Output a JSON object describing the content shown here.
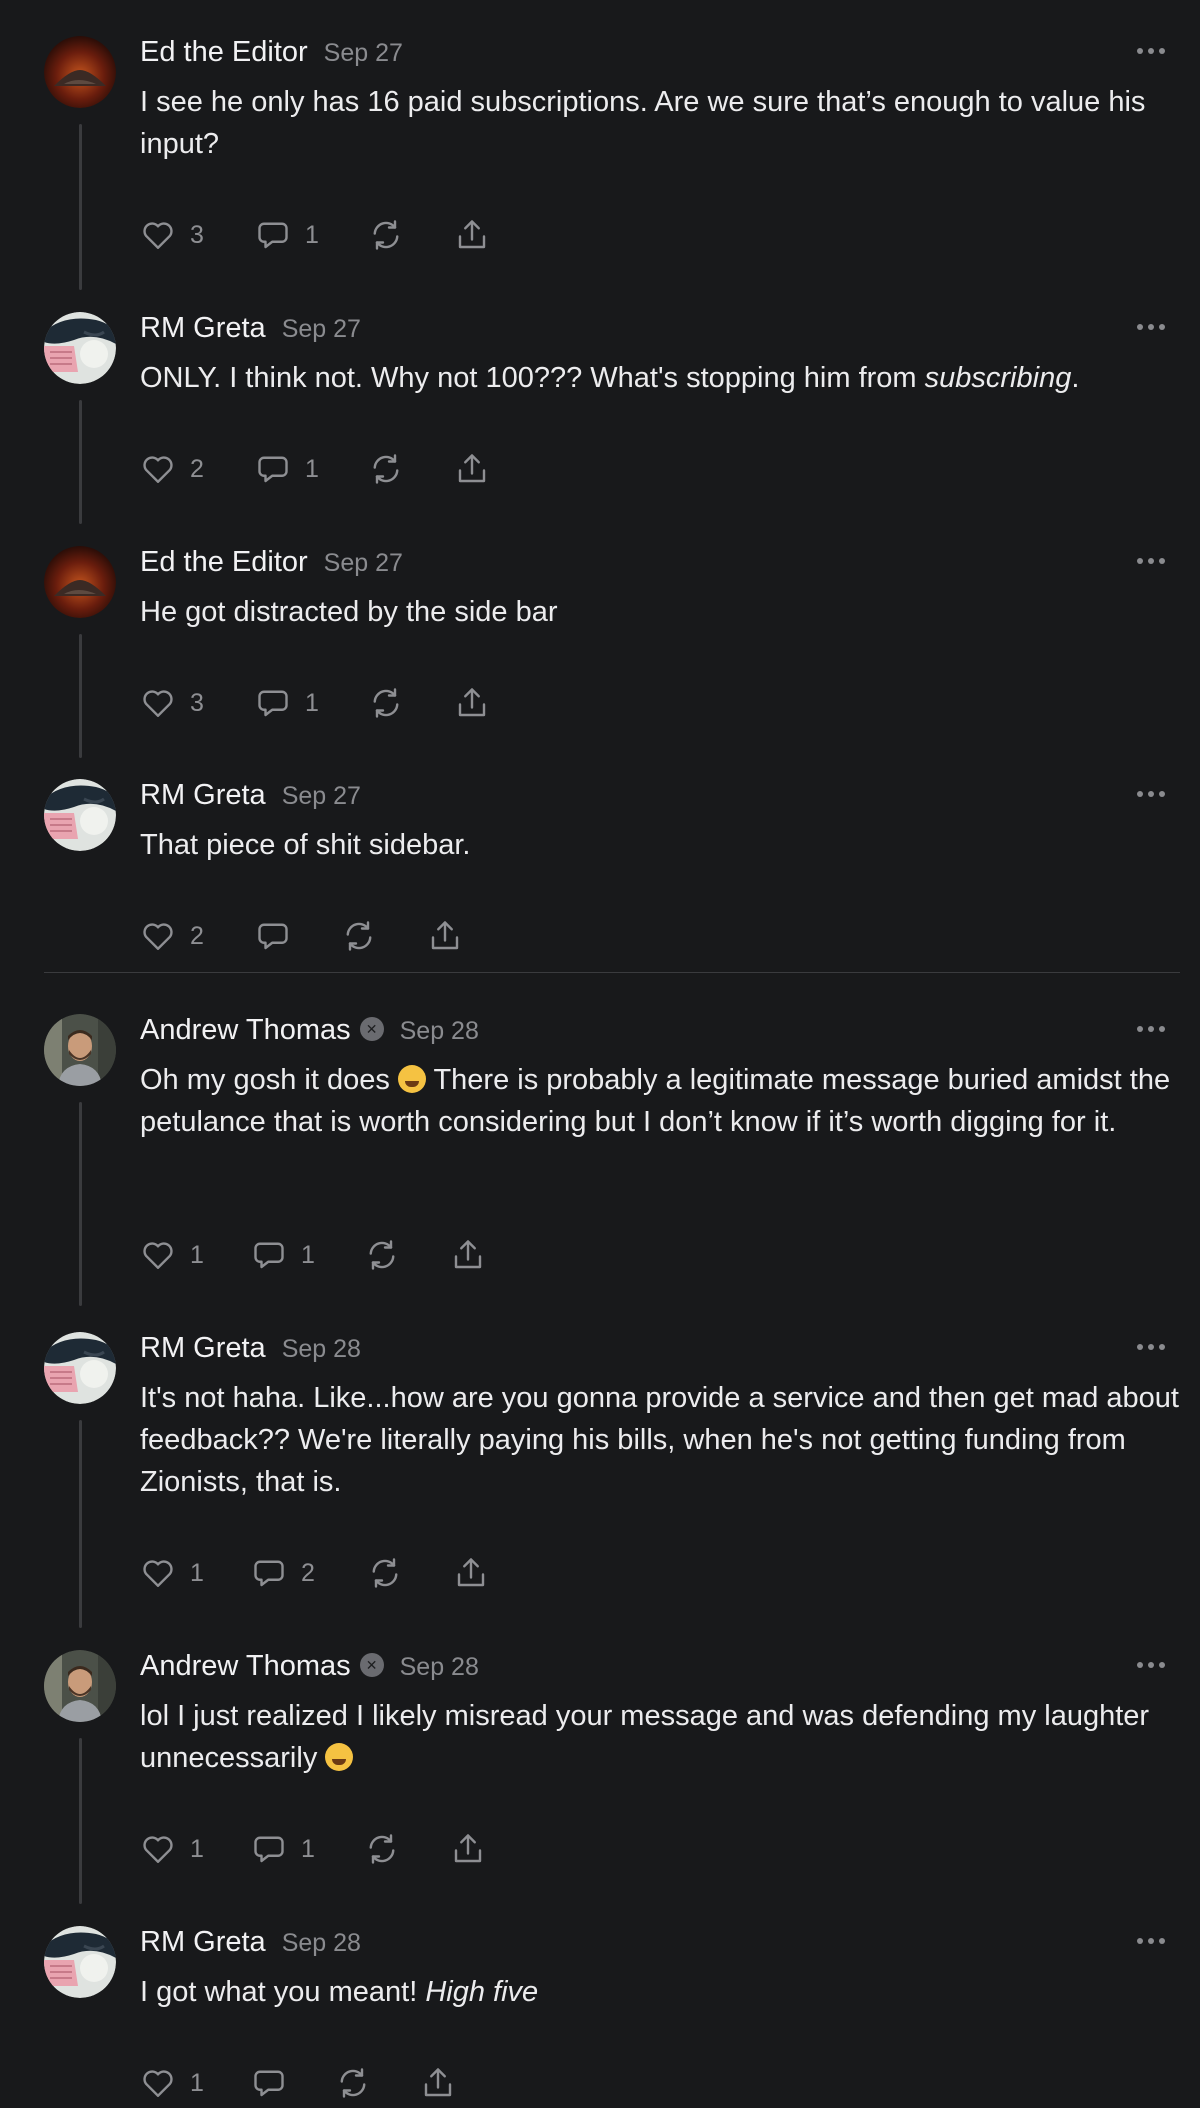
{
  "comments": [
    {
      "author": "Ed the Editor",
      "date": "Sep 27",
      "text": "I see he only has 16 paid subscriptions. Are we sure that’s enough to value his input?",
      "likes": "3",
      "replies": "1",
      "avatar": "mountain"
    },
    {
      "author": "RM Greta",
      "date": "Sep 27",
      "text_before": "ONLY. I think not. Why not 100??? What's stopping him from ",
      "text_em": "subscribing",
      "text_after": ".",
      "likes": "2",
      "replies": "1",
      "avatar": "greta"
    },
    {
      "author": "Ed the Editor",
      "date": "Sep 27",
      "text": "He got distracted by the side bar",
      "likes": "3",
      "replies": "1",
      "avatar": "mountain"
    },
    {
      "author": "RM Greta",
      "date": "Sep 27",
      "text": "That piece of shit sidebar.",
      "likes": "2",
      "replies": "",
      "avatar": "greta"
    },
    {
      "author": "Andrew Thomas",
      "date": "Sep 28",
      "text_before": "Oh my gosh it does ",
      "text_after": " There is probably a legitimate message buried amidst the petulance that is worth considering but I don’t know if it’s worth digging for it.",
      "likes": "1",
      "replies": "1",
      "avatar": "andrew"
    },
    {
      "author": "RM Greta",
      "date": "Sep 28",
      "text": "It's not haha. Like...how are you gonna provide a service and then get mad about feedback?? We're literally paying his bills, when he's not getting funding from Zionists, that is.",
      "likes": "1",
      "replies": "2",
      "avatar": "greta"
    },
    {
      "author": "Andrew Thomas",
      "date": "Sep 28",
      "text_before": "lol I just realized I likely misread your message and was defending my laughter unnecessarily ",
      "text_after": "",
      "likes": "1",
      "replies": "1",
      "avatar": "andrew"
    },
    {
      "author": "RM Greta",
      "date": "Sep 28",
      "text_before": "I got what you meant! ",
      "text_em": "High five",
      "text_after": "",
      "likes": "1",
      "replies": "",
      "avatar": "greta"
    }
  ],
  "icons": {
    "like": "heart-icon",
    "reply": "comment-bubble-icon",
    "restack": "restack-icon",
    "share": "share-icon",
    "more": "more-dots-icon",
    "verified": "verified-badge-icon",
    "emoji": "grinning-squinting-face-emoji"
  },
  "colors": {
    "background": "#18191b",
    "text": "#ececee",
    "muted": "#8a8b8f"
  }
}
